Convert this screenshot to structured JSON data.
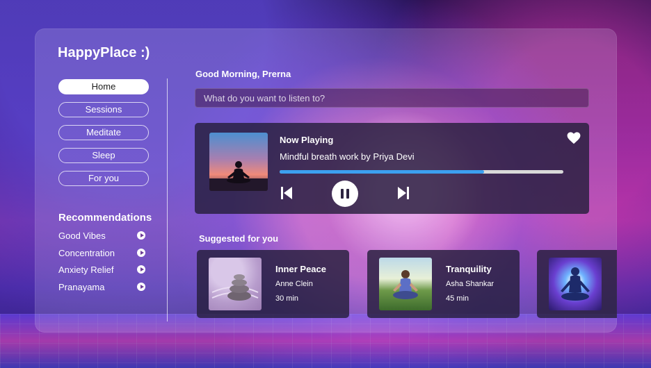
{
  "app": {
    "title": "HappyPlace :)"
  },
  "nav": {
    "items": [
      {
        "label": "Home",
        "active": true
      },
      {
        "label": "Sessions",
        "active": false
      },
      {
        "label": "Meditate",
        "active": false
      },
      {
        "label": "Sleep",
        "active": false
      },
      {
        "label": "For you",
        "active": false
      }
    ]
  },
  "recommendations": {
    "title": "Recommendations",
    "items": [
      {
        "label": "Good Vibes",
        "icon": "play-circle-icon"
      },
      {
        "label": "Concentration",
        "icon": "play-circle-icon"
      },
      {
        "label": "Anxiety Relief",
        "icon": "play-circle-icon"
      },
      {
        "label": "Pranayama",
        "icon": "play-circle-icon"
      }
    ]
  },
  "main": {
    "greeting": "Good Morning, Prerna",
    "search": {
      "placeholder": "What do you want to listen to?",
      "value": ""
    }
  },
  "now_playing": {
    "label": "Now Playing",
    "track": "Mindful breath work by Priya Devi",
    "progress": 0.72,
    "icons": {
      "favorite": "heart-icon",
      "previous": "skip-previous-icon",
      "pause": "pause-icon",
      "next": "skip-next-icon"
    }
  },
  "suggested": {
    "title": "Suggested for you",
    "items": [
      {
        "title": "Inner Peace",
        "author": "Anne Clein",
        "duration": "30 min"
      },
      {
        "title": "Tranquility",
        "author": "Asha Shankar",
        "duration": "45 min"
      },
      {
        "title": "",
        "author": "",
        "duration": ""
      }
    ]
  },
  "colors": {
    "accent": "#3ca0f0",
    "card": "#261e3c",
    "text": "#ffffff"
  }
}
